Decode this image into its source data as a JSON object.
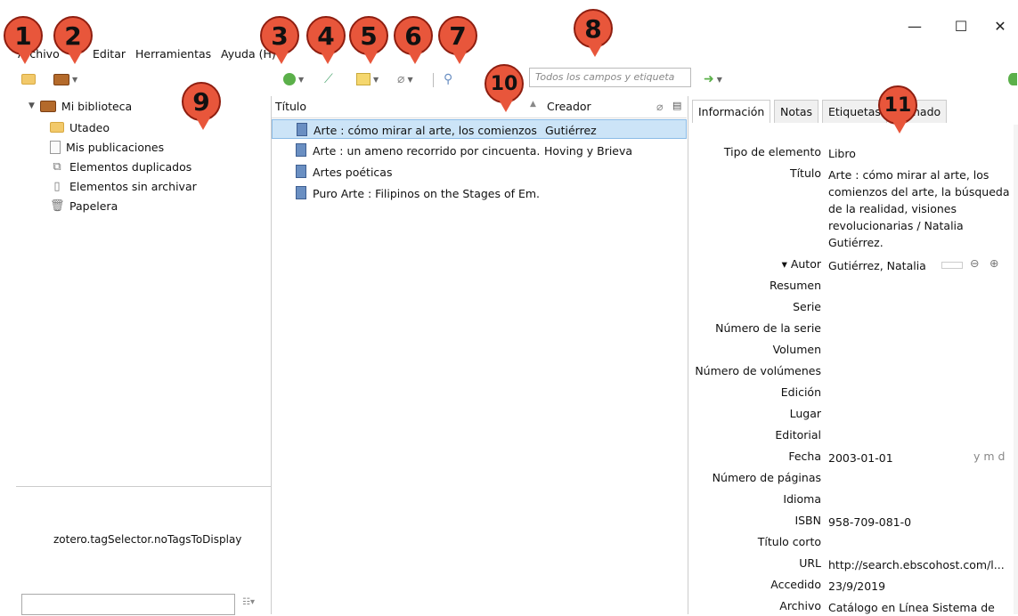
{
  "menus": [
    "Archivo",
    "Editar",
    "Herramientas",
    "Ayuda"
  ],
  "menu_ayuda_shortcut": "(H)",
  "callouts": [
    "1",
    "2",
    "3",
    "4",
    "5",
    "6",
    "7",
    "8",
    "9",
    "10",
    "11"
  ],
  "window_controls": {
    "minimize": "—",
    "maximize": "☐",
    "close": "✕"
  },
  "search": {
    "placeholder": "Todos los campos y etiqueta"
  },
  "tree": [
    {
      "label": "Mi biblioteca",
      "icon": "library-icon"
    },
    {
      "label": "Utadeo",
      "icon": "folder-icon"
    },
    {
      "label": "Mis publicaciones",
      "icon": "document-icon"
    },
    {
      "label": "Elementos duplicados",
      "icon": "duplicates-icon"
    },
    {
      "label": "Elementos sin archivar",
      "icon": "unfiled-icon"
    },
    {
      "label": "Papelera",
      "icon": "trash-icon"
    }
  ],
  "tag_selector": {
    "message": "zotero.tagSelector.noTagsToDisplay"
  },
  "columns": {
    "title": "Título",
    "creator": "Creador"
  },
  "items": [
    {
      "title": "Arte : cómo mirar al arte, los comienzos ...",
      "creator": "Gutiérrez"
    },
    {
      "title": "Arte : un ameno recorrido por cincuenta...",
      "creator": "Hoving y Brieva"
    },
    {
      "title": "Artes poéticas",
      "creator": ""
    },
    {
      "title": "Puro Arte : Filipinos on the Stages of Em...",
      "creator": ""
    }
  ],
  "tabs": [
    "Información",
    "Notas",
    "Etiquetas",
    "cionado"
  ],
  "fields": [
    {
      "label": "Tipo de elemento",
      "value": "Libro"
    },
    {
      "label": "Título",
      "value": "Arte : cómo mirar al arte, los comienzos del arte, la búsqueda de la realidad, visiones revolucionarias / Natalia Gutiérrez."
    },
    {
      "label": "▾  Autor",
      "value": "Gutiérrez, Natalia"
    },
    {
      "label": "Resumen",
      "value": ""
    },
    {
      "label": "Serie",
      "value": ""
    },
    {
      "label": "Número de la serie",
      "value": ""
    },
    {
      "label": "Volumen",
      "value": ""
    },
    {
      "label": "Número de volúmenes",
      "value": ""
    },
    {
      "label": "Edición",
      "value": ""
    },
    {
      "label": "Lugar",
      "value": ""
    },
    {
      "label": "Editorial",
      "value": ""
    },
    {
      "label": "Fecha",
      "value": "2003-01-01"
    },
    {
      "label": "Número de páginas",
      "value": ""
    },
    {
      "label": "Idioma",
      "value": ""
    },
    {
      "label": "ISBN",
      "value": "958-709-081-0"
    },
    {
      "label": "Título corto",
      "value": ""
    },
    {
      "label": "URL",
      "value": "http://search.ebscohost.com/l..."
    },
    {
      "label": "Accedido",
      "value": "23/9/2019"
    },
    {
      "label": "Archivo",
      "value": "Catálogo en Línea Sistema de"
    }
  ],
  "date_format": "y m d"
}
